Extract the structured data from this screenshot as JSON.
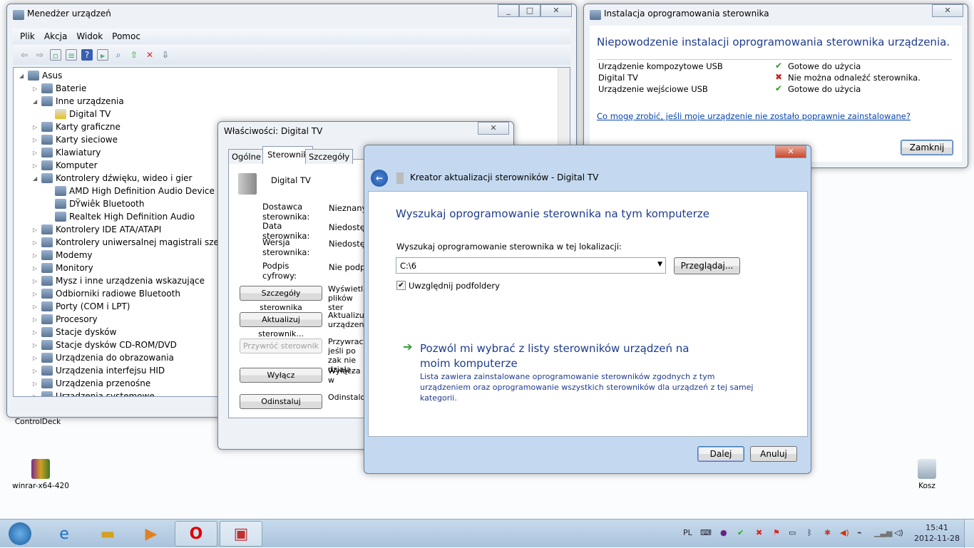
{
  "desktop": {
    "icons": [
      {
        "label": "ControlDeck"
      },
      {
        "label": "winrar-x64-420"
      },
      {
        "label": "Kosz"
      }
    ]
  },
  "devmgr": {
    "title": "Menedżer urządzeń",
    "menu": [
      "Plik",
      "Akcja",
      "Widok",
      "Pomoc"
    ],
    "toolbar": [
      "back-icon",
      "forward-icon",
      "show-hide-console-tree-icon",
      "properties-icon",
      "help-icon",
      "action-pane-icon",
      "scan-hardware-icon",
      "update-driver-icon",
      "disable-device-icon",
      "uninstall-device-icon"
    ],
    "tree": [
      {
        "label": "Asus",
        "level": 0,
        "expanded": true
      },
      {
        "label": "Baterie",
        "level": 1
      },
      {
        "label": "Inne urządzenia",
        "level": 1,
        "expanded": true
      },
      {
        "label": "Digital TV",
        "level": 2,
        "warning": true
      },
      {
        "label": "Karty graficzne",
        "level": 1
      },
      {
        "label": "Karty sieciowe",
        "level": 1
      },
      {
        "label": "Klawiatury",
        "level": 1
      },
      {
        "label": "Komputer",
        "level": 1
      },
      {
        "label": "Kontrolery dźwięku, wideo i gier",
        "level": 1,
        "expanded": true
      },
      {
        "label": "AMD High Definition Audio Device",
        "level": 2
      },
      {
        "label": "DŸwiêk Bluetooth",
        "level": 2
      },
      {
        "label": "Realtek High Definition Audio",
        "level": 2
      },
      {
        "label": "Kontrolery IDE ATA/ATAPI",
        "level": 1
      },
      {
        "label": "Kontrolery uniwersalnej magistrali szeregowej",
        "level": 1
      },
      {
        "label": "Modemy",
        "level": 1
      },
      {
        "label": "Monitory",
        "level": 1
      },
      {
        "label": "Mysz i inne urządzenia wskazujące",
        "level": 1
      },
      {
        "label": "Odbiorniki radiowe Bluetooth",
        "level": 1
      },
      {
        "label": "Porty (COM i LPT)",
        "level": 1
      },
      {
        "label": "Procesory",
        "level": 1
      },
      {
        "label": "Stacje dysków",
        "level": 1
      },
      {
        "label": "Stacje dysków CD-ROM/DVD",
        "level": 1
      },
      {
        "label": "Urządzenia do obrazowania",
        "level": 1
      },
      {
        "label": "Urządzenia interfejsu HID",
        "level": 1
      },
      {
        "label": "Urządzenia przenośne",
        "level": 1
      },
      {
        "label": "Urządzenia systemowe",
        "level": 1
      }
    ]
  },
  "install": {
    "title": "Instalacja oprogramowania sterownika",
    "heading": "Niepowodzenie instalacji oprogramowania sterownika urządzenia.",
    "devices": [
      {
        "name": "Urządzenie kompozytowe USB",
        "status": "Gotowe do użycia",
        "ok": true
      },
      {
        "name": "Digital TV",
        "status": "Nie można odnaleźć sterownika.",
        "ok": false
      },
      {
        "name": "Urządzenie wejściowe USB",
        "status": "Gotowe do użycia",
        "ok": true
      }
    ],
    "link": "Co mogę zrobić, jeśli moje urządzenie nie zostało poprawnie zainstalowane?",
    "close": "Zamknij"
  },
  "props": {
    "title": "Właściwości: Digital TV",
    "tabs": [
      "Ogólne",
      "Sterownik",
      "Szczegóły"
    ],
    "active_tab": "Sterownik",
    "device": "Digital TV",
    "fields": [
      {
        "label": "Dostawca sterownika:",
        "value": "Nieznany"
      },
      {
        "label": "Data sterownika:",
        "value": "Niedostęp"
      },
      {
        "label": "Wersja sterownika:",
        "value": "Niedostęp"
      },
      {
        "label": "Podpis cyfrowy:",
        "value": "Nie podpis"
      }
    ],
    "buttons": [
      {
        "label": "Szczegóły sterownika",
        "desc": "Wyświetla plików ster"
      },
      {
        "label": "Aktualizuj sterownik...",
        "desc": "Aktualizuje urządzenia"
      },
      {
        "label": "Przywróć sterownik",
        "desc": "Przywraca jeśli po zak nie działa.",
        "disabled": true
      },
      {
        "label": "Wyłącz",
        "desc": "Wyłącza w"
      },
      {
        "label": "Odinstaluj",
        "desc": "Odinstalow"
      }
    ]
  },
  "wizard": {
    "title": "Kreator aktualizacji sterowników - Digital TV",
    "heading": "Wyszukaj oprogramowanie sterownika na tym komputerze",
    "location_label": "Wyszukaj oprogramowanie sterownika w tej lokalizacji:",
    "location_value": "C:\\6",
    "browse": "Przeglądaj...",
    "subfolders_label": "Uwzględnij podfoldery",
    "subfolders_checked": true,
    "option_title": "Pozwól mi wybrać z listy sterowników urządzeń na moim komputerze",
    "option_desc": "Lista zawiera zainstalowane oprogramowanie sterowników zgodnych z tym urządzeniem oraz oprogramowanie wszystkich sterowników dla urządzeń z tej samej kategorii.",
    "next": "Dalej",
    "cancel": "Anuluj"
  },
  "taskbar": {
    "lang": "PL",
    "time": "15:41",
    "date": "2012-11-28",
    "pinned": [
      "start-orb",
      "internet-explorer",
      "windows-explorer",
      "media-player",
      "opera",
      "device-manager"
    ]
  },
  "colors": {
    "heading": "#1e3c8c",
    "link": "#0645ad",
    "ok": "#2a9a2a",
    "error": "#d02020"
  }
}
